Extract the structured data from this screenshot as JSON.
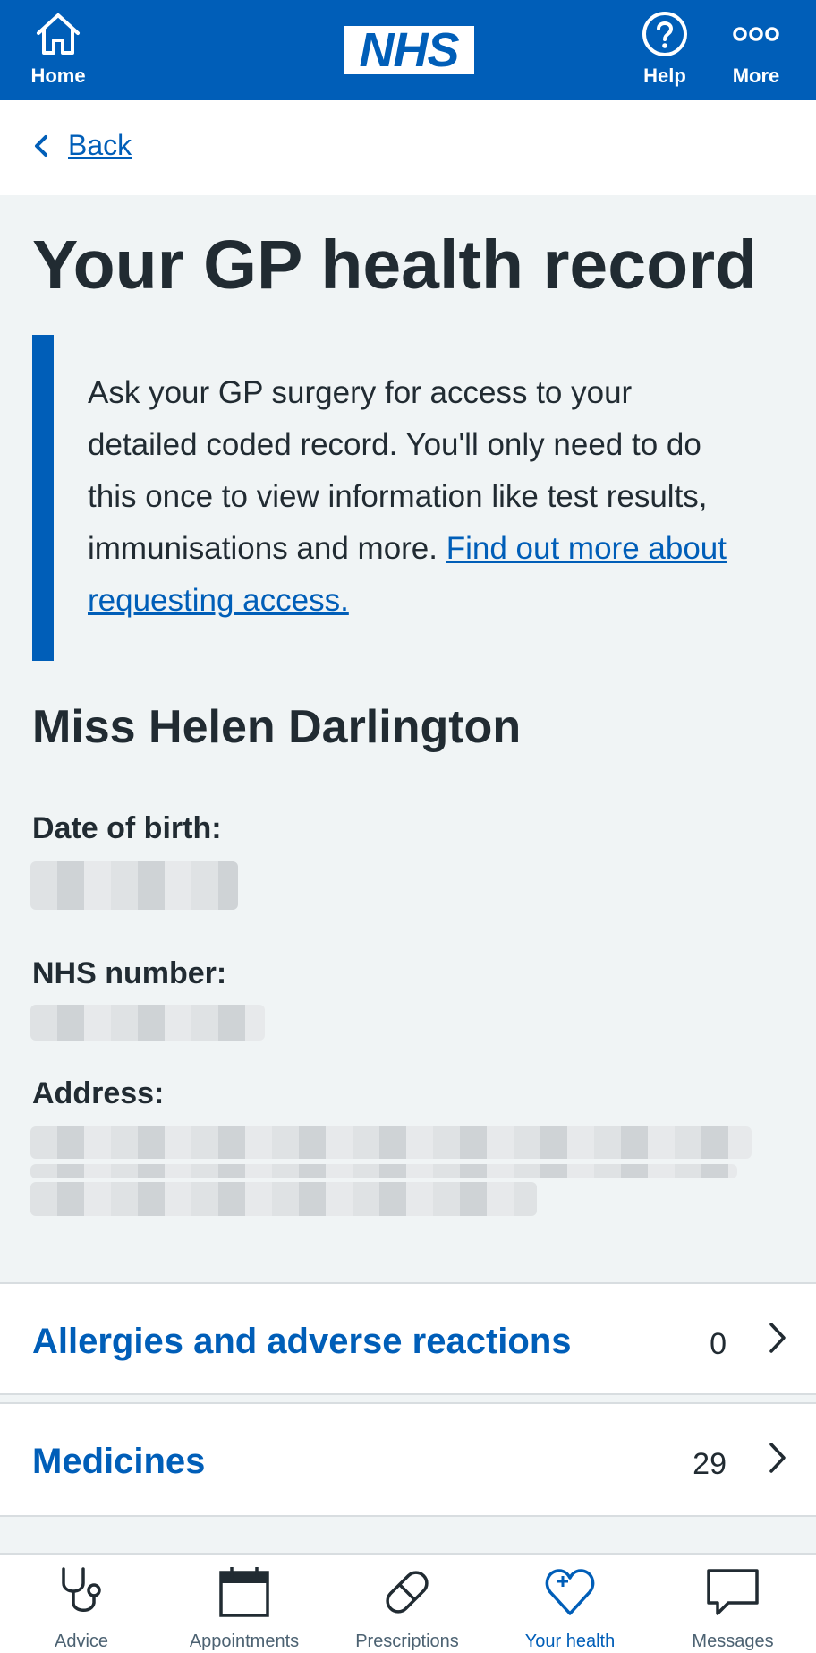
{
  "header": {
    "logo": "NHS",
    "home_label": "Home",
    "help_label": "Help",
    "more_label": "More"
  },
  "back_label": "Back",
  "page_title": "Your GP health record",
  "inset": {
    "text": "Ask your GP surgery for access to your detailed coded record. You'll only need to do this once to view information like test results, immunisations and more.",
    "link": "Find out more about requesting access."
  },
  "patient": {
    "name": "Miss Helen Darlington",
    "dob_label": "Date of birth:",
    "nhs_label": "NHS number:",
    "address_label": "Address:"
  },
  "sections": [
    {
      "label": "Allergies and adverse reactions",
      "count": "0"
    },
    {
      "label": "Medicines",
      "count": "29"
    }
  ],
  "bottom_nav": [
    {
      "label": "Advice",
      "icon": "stethoscope-icon"
    },
    {
      "label": "Appointments",
      "icon": "calendar-icon"
    },
    {
      "label": "Prescriptions",
      "icon": "pill-icon"
    },
    {
      "label": "Your health",
      "icon": "heart-plus-icon",
      "active": true
    },
    {
      "label": "Messages",
      "icon": "message-icon"
    }
  ],
  "colors": {
    "brand_blue": "#005eb8",
    "background": "#f0f4f5",
    "text": "#212b32"
  }
}
